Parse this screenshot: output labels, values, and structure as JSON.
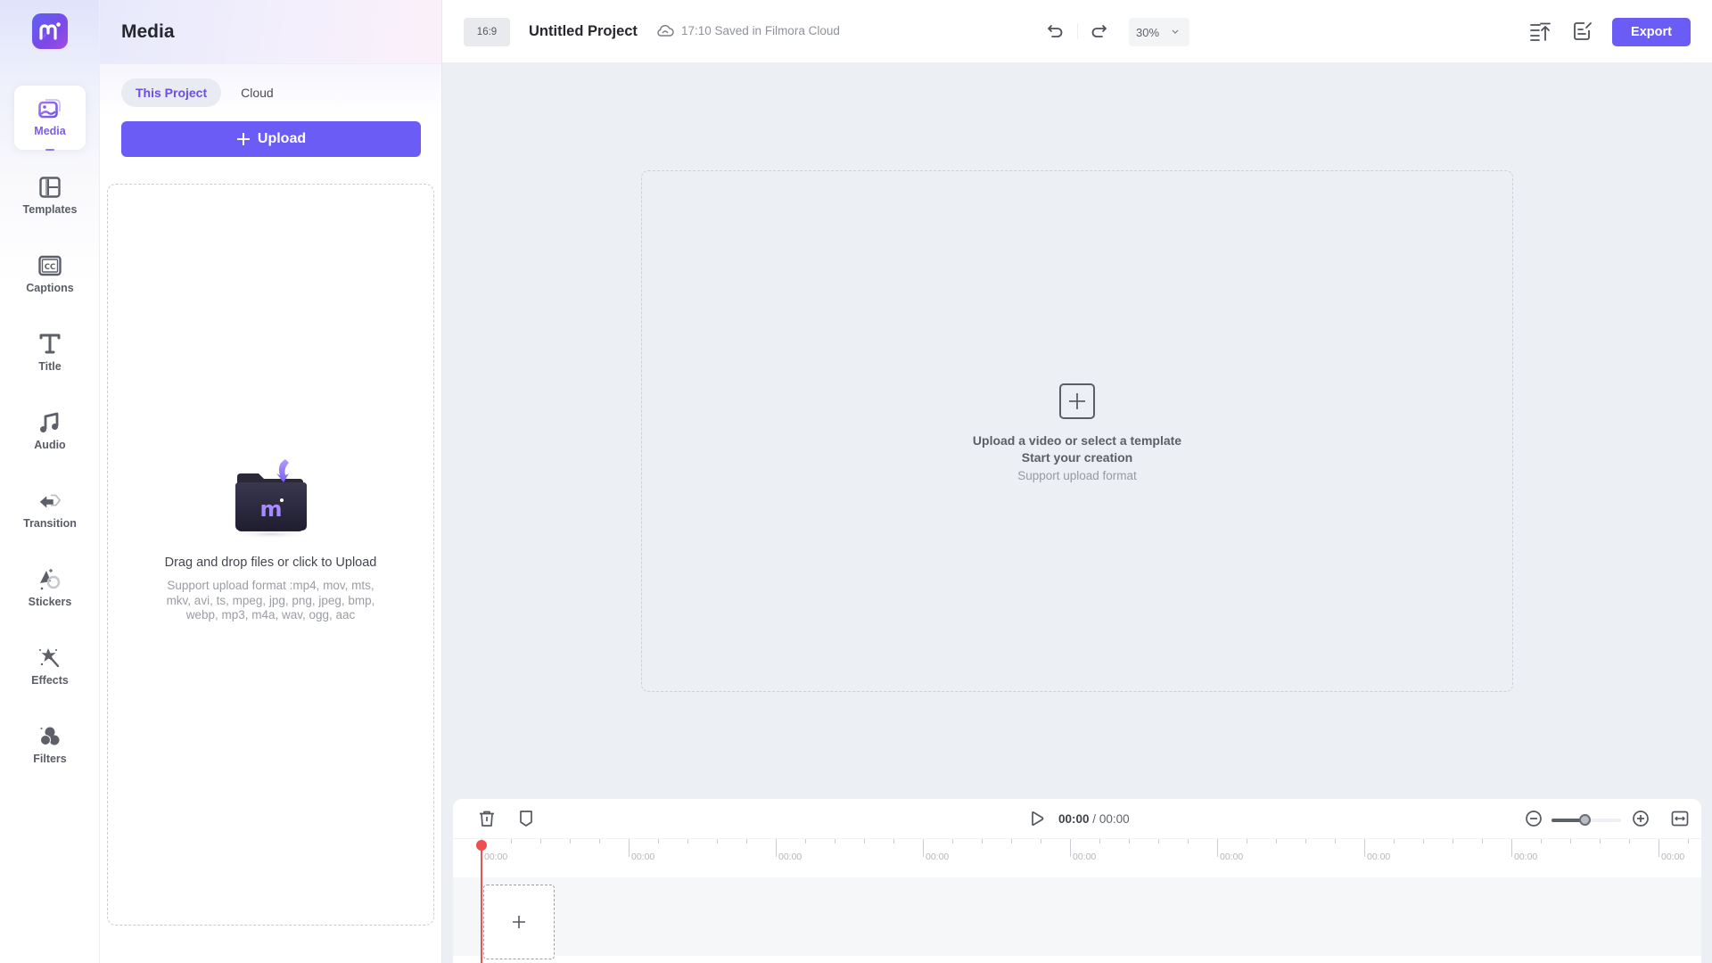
{
  "app": {
    "brand_color": "#6b5cf6",
    "accent_text_color": "#7d5ce6"
  },
  "rail": {
    "items": [
      {
        "id": "media",
        "label": "Media",
        "icon": "media-image-icon",
        "active": true
      },
      {
        "id": "templates",
        "label": "Templates",
        "icon": "templates-layout-icon",
        "active": false
      },
      {
        "id": "captions",
        "label": "Captions",
        "icon": "captions-cc-icon",
        "active": false
      },
      {
        "id": "title",
        "label": "Title",
        "icon": "title-text-icon",
        "active": false
      },
      {
        "id": "audio",
        "label": "Audio",
        "icon": "audio-music-note-icon",
        "active": false
      },
      {
        "id": "transition",
        "label": "Transition",
        "icon": "transition-arrows-icon",
        "active": false
      },
      {
        "id": "stickers",
        "label": "Stickers",
        "icon": "stickers-shapes-icon",
        "active": false
      },
      {
        "id": "effects",
        "label": "Effects",
        "icon": "effects-magic-wand-icon",
        "active": false
      },
      {
        "id": "filters",
        "label": "Filters",
        "icon": "filters-circles-icon",
        "active": false
      }
    ]
  },
  "panel": {
    "title": "Media",
    "tabs": [
      {
        "label": "This Project",
        "active": true
      },
      {
        "label": "Cloud",
        "active": false
      }
    ],
    "upload_label": "Upload",
    "dropzone": {
      "title": "Drag and drop files or click to Upload",
      "formats": "Support upload format :mp4, mov, mts, mkv, avi, ts, mpeg, jpg, png, jpeg, bmp, webp, mp3, m4a, wav, ogg, aac"
    }
  },
  "topbar": {
    "aspect_ratio": "16:9",
    "project_name": "Untitled Project",
    "save_status": "17:10 Saved in Filmora Cloud",
    "zoom_level": "30%",
    "export_label": "Export"
  },
  "canvas": {
    "line1": "Upload a video or select a template",
    "line2": "Start your creation",
    "line3": "Support upload format"
  },
  "timeline": {
    "current_time": "00:00",
    "separator": "/",
    "total_time": "00:00",
    "zoom_fraction": 0.47,
    "ruler_labels": [
      "00:00",
      "00:00",
      "00:00",
      "00:00",
      "00:00",
      "00:00",
      "00:00",
      "00:00",
      "00:00"
    ]
  }
}
